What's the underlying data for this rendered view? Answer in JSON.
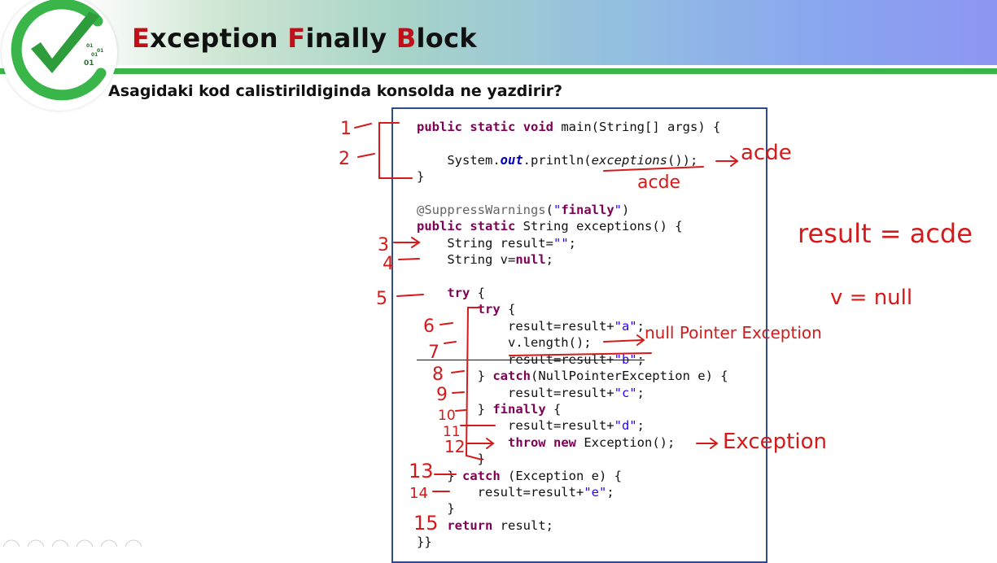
{
  "slide": {
    "title_parts": [
      {
        "cap": "E",
        "rest": "xception "
      },
      {
        "cap": "F",
        "rest": "inally "
      },
      {
        "cap": "B",
        "rest": "lock"
      }
    ],
    "question": "Asagidaki kod calistirildiginda konsolda ne yazdirir?",
    "logo_text": [
      "01",
      "01",
      "01",
      "01"
    ]
  },
  "code_lines": [
    "public static void main(String[] args) {",
    "",
    "    System.out.println(exceptions());",
    "}",
    "",
    "@SuppressWarnings(\"finally\")",
    "public static String exceptions() {",
    "    String result=\"\";",
    "    String v=null;",
    "",
    "    try {",
    "        try {",
    "            result=result+\"a\";",
    "            v.length();",
    "            result=result+\"b\";",
    "        } catch(NullPointerException e) {",
    "            result=result+\"c\";",
    "        } finally {",
    "            result=result+\"d\";",
    "            throw new Exception();",
    "        }",
    "    } catch (Exception e) {",
    "        result=result+\"e\";",
    "    }",
    "    return result;",
    "}}"
  ],
  "annotations": {
    "line_numbers": [
      "1",
      "2",
      "3",
      "4",
      "5",
      "6",
      "7",
      "8",
      "9",
      "10",
      "11",
      "12",
      "13",
      "14",
      "15"
    ],
    "output_1": "acde",
    "output_2": "acde",
    "result_note": "result = acde",
    "v_note": "v = null",
    "npe_note": "null Pointer Exception",
    "exception_note": "Exception"
  },
  "colors": {
    "title_accent": "#c0101a",
    "keyword": "#7f0055",
    "string": "#2a00ff",
    "annotation_ink": "#d41a1a",
    "code_border": "#2e4c8c",
    "green_bar": "#3ab54a"
  }
}
